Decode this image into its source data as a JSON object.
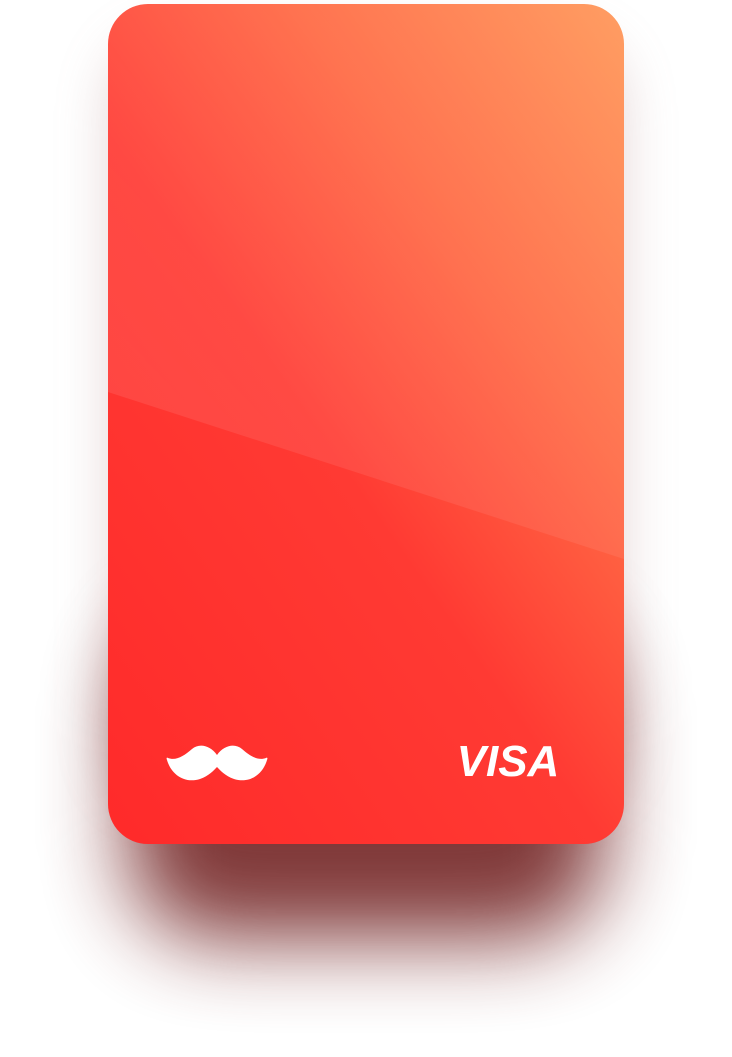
{
  "card": {
    "brand_logo_icon": "mustache-icon",
    "network": "VISA",
    "colors": {
      "gradient_top_right": "#ff9a5c",
      "gradient_mid": "#ff5e3e",
      "gradient_bottom_left": "#ff2a2a",
      "logo": "#ffffff",
      "shadow": "#7a2f2f"
    }
  }
}
